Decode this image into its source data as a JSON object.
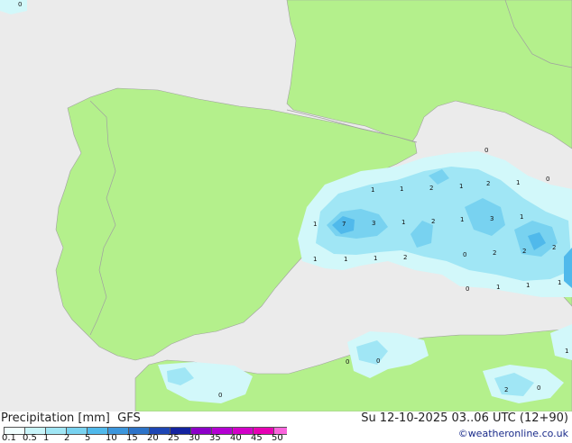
{
  "header": {
    "product": "Precipitation [mm]",
    "model": "GFS",
    "valid_time": "Su 12-10-2025 03..06 UTC (12+90)",
    "credit": "©weatheronline.co.uk"
  },
  "colorbar": {
    "ticks": [
      "0.1",
      "0.5",
      "1",
      "2",
      "5",
      "10",
      "15",
      "20",
      "25",
      "30",
      "35",
      "40",
      "45",
      "50"
    ],
    "colors": [
      "#f0ffff",
      "#c8f5fa",
      "#a0e6f5",
      "#78d2f0",
      "#50b9eb",
      "#3c96dc",
      "#2d73c8",
      "#1e46b4",
      "#1423a0",
      "#8c00c8",
      "#b400d2",
      "#d200c8",
      "#e600b4",
      "#fa64dc"
    ]
  },
  "map": {
    "land_color": "#b4f08c",
    "sea_color": "#ebebeb",
    "border_color": "#a0a0a0",
    "rain_labels": [
      "0",
      "0",
      "1",
      "1",
      "2",
      "1",
      "2",
      "1",
      "0",
      "1",
      "7",
      "3",
      "1",
      "2",
      "1",
      "3",
      "1",
      "0",
      "1",
      "1",
      "1",
      "2",
      "2",
      "2",
      "4",
      "2",
      "0",
      "1",
      "1",
      "1",
      "0",
      "0",
      "0",
      "2",
      "0",
      "1"
    ]
  }
}
